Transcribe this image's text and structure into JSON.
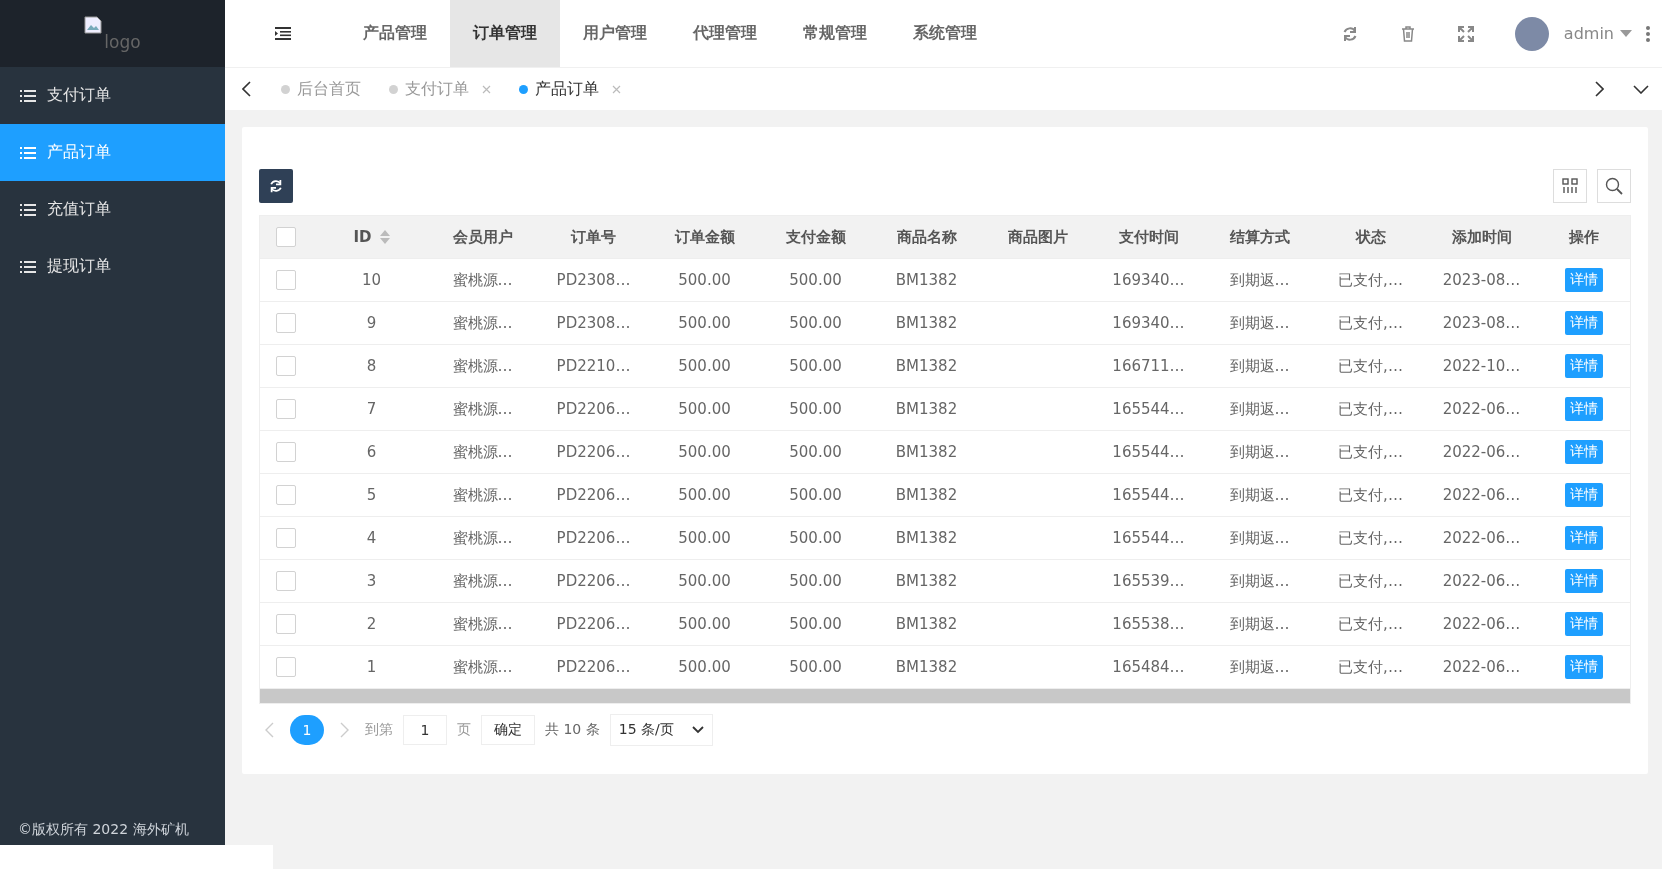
{
  "logo": {
    "alt": "logo"
  },
  "sidebar": {
    "items": [
      {
        "label": "支付订单",
        "selected": false
      },
      {
        "label": "产品订单",
        "selected": true
      },
      {
        "label": "充值订单",
        "selected": false
      },
      {
        "label": "提现订单",
        "selected": false
      }
    ],
    "copyright": "©版权所有 2022 海外矿机"
  },
  "top_menu": [
    {
      "label": "产品管理",
      "selected": false
    },
    {
      "label": "订单管理",
      "selected": true
    },
    {
      "label": "用户管理",
      "selected": false
    },
    {
      "label": "代理管理",
      "selected": false
    },
    {
      "label": "常规管理",
      "selected": false
    },
    {
      "label": "系统管理",
      "selected": false
    }
  ],
  "user": {
    "name": "admin"
  },
  "tabs": [
    {
      "label": "后台首页",
      "selected": false,
      "closable": false
    },
    {
      "label": "支付订单",
      "selected": false,
      "closable": true
    },
    {
      "label": "产品订单",
      "selected": true,
      "closable": true
    }
  ],
  "table": {
    "header_checked": false,
    "columns": [
      "ID",
      "会员用户",
      "订单号",
      "订单金额",
      "支付金额",
      "商品名称",
      "商品图片",
      "支付时间",
      "结算方式",
      "状态",
      "添加时间",
      "操作"
    ],
    "rows": [
      {
        "checked": false,
        "cells": [
          "10",
          "蜜桃源…",
          "PD2308…",
          "500.00",
          "500.00",
          "BM1382",
          "",
          "169340…",
          "到期返…",
          "已支付,…",
          "2023-08…"
        ],
        "action": "详情"
      },
      {
        "checked": false,
        "cells": [
          "9",
          "蜜桃源…",
          "PD2308…",
          "500.00",
          "500.00",
          "BM1382",
          "",
          "169340…",
          "到期返…",
          "已支付,…",
          "2023-08…"
        ],
        "action": "详情"
      },
      {
        "checked": false,
        "cells": [
          "8",
          "蜜桃源…",
          "PD2210…",
          "500.00",
          "500.00",
          "BM1382",
          "",
          "166711…",
          "到期返…",
          "已支付,…",
          "2022-10…"
        ],
        "action": "详情"
      },
      {
        "checked": false,
        "cells": [
          "7",
          "蜜桃源…",
          "PD2206…",
          "500.00",
          "500.00",
          "BM1382",
          "",
          "165544…",
          "到期返…",
          "已支付,…",
          "2022-06…"
        ],
        "action": "详情"
      },
      {
        "checked": false,
        "cells": [
          "6",
          "蜜桃源…",
          "PD2206…",
          "500.00",
          "500.00",
          "BM1382",
          "",
          "165544…",
          "到期返…",
          "已支付,…",
          "2022-06…"
        ],
        "action": "详情"
      },
      {
        "checked": false,
        "cells": [
          "5",
          "蜜桃源…",
          "PD2206…",
          "500.00",
          "500.00",
          "BM1382",
          "",
          "165544…",
          "到期返…",
          "已支付,…",
          "2022-06…"
        ],
        "action": "详情"
      },
      {
        "checked": false,
        "cells": [
          "4",
          "蜜桃源…",
          "PD2206…",
          "500.00",
          "500.00",
          "BM1382",
          "",
          "165544…",
          "到期返…",
          "已支付,…",
          "2022-06…"
        ],
        "action": "详情"
      },
      {
        "checked": false,
        "cells": [
          "3",
          "蜜桃源…",
          "PD2206…",
          "500.00",
          "500.00",
          "BM1382",
          "",
          "165539…",
          "到期返…",
          "已支付,…",
          "2022-06…"
        ],
        "action": "详情"
      },
      {
        "checked": false,
        "cells": [
          "2",
          "蜜桃源…",
          "PD2206…",
          "500.00",
          "500.00",
          "BM1382",
          "",
          "165538…",
          "到期返…",
          "已支付,…",
          "2022-06…"
        ],
        "action": "详情"
      },
      {
        "checked": false,
        "cells": [
          "1",
          "蜜桃源…",
          "PD2206…",
          "500.00",
          "500.00",
          "BM1382",
          "",
          "165484…",
          "到期返…",
          "已支付,…",
          "2022-06…"
        ],
        "action": "详情"
      }
    ]
  },
  "pagination": {
    "pages": [
      {
        "label": "1",
        "selected": true
      }
    ],
    "goto_label": "到第",
    "goto_value": "1",
    "page_unit": "页",
    "confirm": "确定",
    "total": "共 10 条",
    "page_size": "15 条/页"
  }
}
